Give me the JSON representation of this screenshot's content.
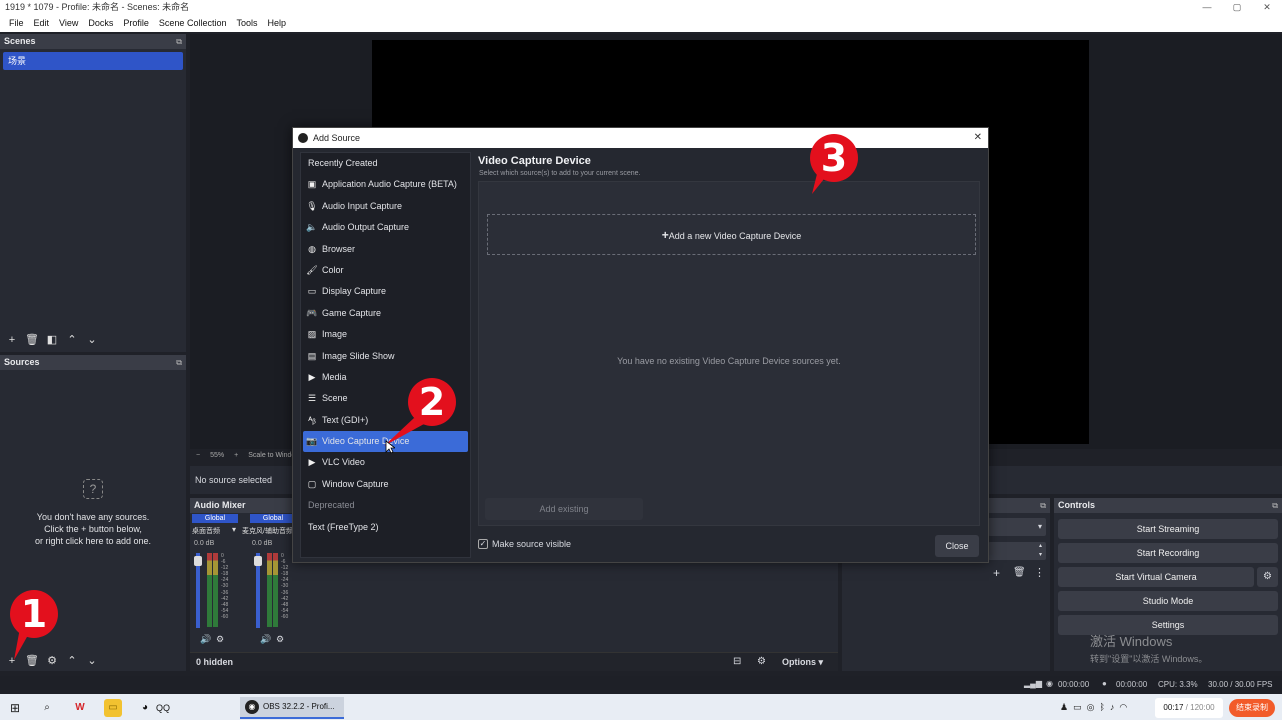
{
  "window": {
    "title": "1919 * 1079 - Profile: 未命名 - Scenes: 未命名",
    "min": "—",
    "max": "▢",
    "close": "✕"
  },
  "menu": [
    "File",
    "Edit",
    "View",
    "Docks",
    "Profile",
    "Scene Collection",
    "Tools",
    "Help"
  ],
  "scenes": {
    "title": "Scenes",
    "items": [
      "场景"
    ]
  },
  "sources": {
    "title": "Sources",
    "empty_l1": "You don't have any sources.",
    "empty_l2": "Click the + button below,",
    "empty_l3": "or right click here to add one.",
    "question": "?"
  },
  "preview_bar": {
    "minus": "−",
    "zoom": "55%",
    "plus": "+",
    "scale_label": "Scale to Window"
  },
  "properties": {
    "no_source": "No source selected"
  },
  "audio_mixer": {
    "title": "Audio Mixer",
    "channels": [
      {
        "badge": "Global",
        "name": "桌面音频",
        "db": "0.0 dB"
      },
      {
        "badge": "Global",
        "name": "麦克风/辅助音频",
        "db": "0.0 dB"
      }
    ],
    "scale": [
      "0",
      "-6",
      "-12",
      "-18",
      "-24",
      "-30",
      "-36",
      "-42",
      "-48",
      "-54",
      "-60"
    ],
    "hidden": "0 hidden",
    "options": "Options"
  },
  "controls": {
    "title": "Controls",
    "start_streaming": "Start Streaming",
    "start_recording": "Start Recording",
    "start_virtual_camera": "Start Virtual Camera",
    "studio_mode": "Studio Mode",
    "settings": "Settings"
  },
  "watermark": {
    "line1": "激活 Windows",
    "line2": "转到\"设置\"以激活 Windows。"
  },
  "statusbar": {
    "stream_time": "00:00:00",
    "rec_time": "00:00:00",
    "cpu": "CPU: 3.3%",
    "fps": "30.00 / 30.00 FPS"
  },
  "dialog": {
    "title": "Add Source",
    "close_x": "✕",
    "list": {
      "recently_created": "Recently Created",
      "items": [
        "Application Audio Capture (BETA)",
        "Audio Input Capture",
        "Audio Output Capture",
        "Browser",
        "Color",
        "Display Capture",
        "Game Capture",
        "Image",
        "Image Slide Show",
        "Media",
        "Scene",
        "Text (GDI+)",
        "Video Capture Device",
        "VLC Video",
        "Window Capture"
      ],
      "deprecated": "Deprecated",
      "deprecated_items": [
        "Text (FreeType 2)"
      ]
    },
    "heading": "Video Capture Device",
    "subheading": "Select which source(s) to add to your current scene.",
    "add_new": "Add a new Video Capture Device",
    "empty": "You have no existing Video Capture Device sources yet.",
    "add_existing": "Add existing",
    "make_visible": "Make source visible",
    "close": "Close"
  },
  "annotations": {
    "one": "1",
    "two": "2",
    "three": "3"
  },
  "taskbar": {
    "obs_label": "OBS 32.2.2 - Profi...",
    "qq": "QQ",
    "timer": "00:17",
    "timer_total": "/ 120:00",
    "record_btn": "结束录制"
  }
}
